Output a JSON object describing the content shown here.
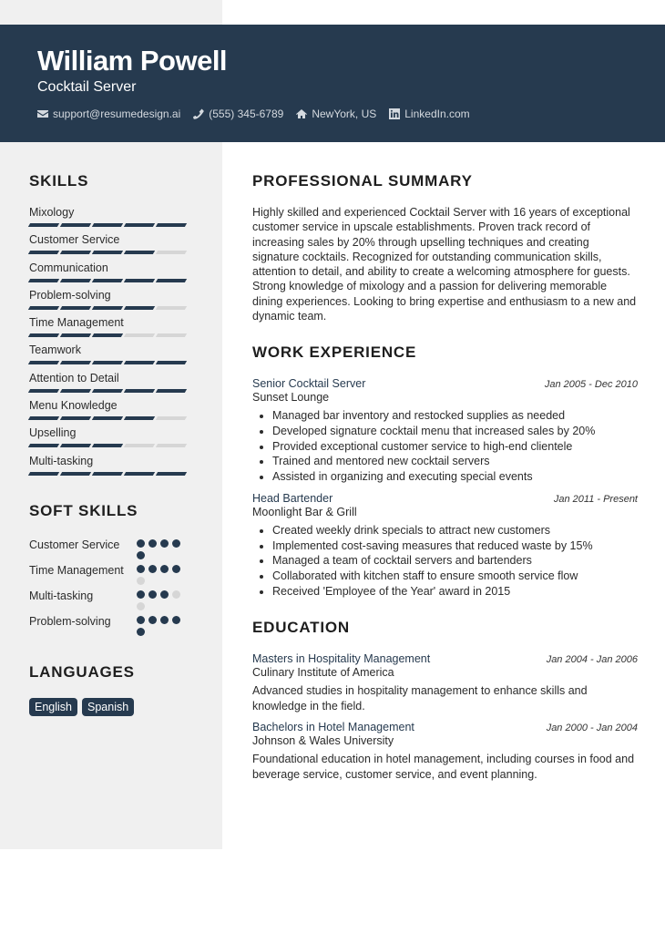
{
  "header": {
    "name": "William Powell",
    "title": "Cocktail Server",
    "contacts": [
      {
        "icon": "envelope-icon",
        "text": "support@resumedesign.ai"
      },
      {
        "icon": "phone-icon",
        "text": "(555) 345-6789"
      },
      {
        "icon": "home-icon",
        "text": "NewYork, US"
      },
      {
        "icon": "linkedin-icon",
        "text": "LinkedIn.com"
      }
    ]
  },
  "sidebar": {
    "skills_heading": "SKILLS",
    "skills": [
      {
        "name": "Mixology",
        "level": 5,
        "max": 5
      },
      {
        "name": "Customer Service",
        "level": 4,
        "max": 5
      },
      {
        "name": "Communication",
        "level": 5,
        "max": 5
      },
      {
        "name": "Problem-solving",
        "level": 4,
        "max": 5
      },
      {
        "name": "Time Management",
        "level": 3,
        "max": 5
      },
      {
        "name": "Teamwork",
        "level": 5,
        "max": 5
      },
      {
        "name": "Attention to Detail",
        "level": 5,
        "max": 5
      },
      {
        "name": "Menu Knowledge",
        "level": 4,
        "max": 5
      },
      {
        "name": "Upselling",
        "level": 3,
        "max": 5
      },
      {
        "name": "Multi-tasking",
        "level": 5,
        "max": 5
      }
    ],
    "soft_skills_heading": "SOFT SKILLS",
    "soft_skills": [
      {
        "name": "Customer Service",
        "level": 5,
        "max": 5
      },
      {
        "name": "Time Management",
        "level": 4,
        "max": 5
      },
      {
        "name": "Multi-tasking",
        "level": 3,
        "max": 5
      },
      {
        "name": "Problem-solving",
        "level": 5,
        "max": 5
      }
    ],
    "languages_heading": "LANGUAGES",
    "languages": [
      "English",
      "Spanish"
    ]
  },
  "main": {
    "summary_heading": "PROFESSIONAL SUMMARY",
    "summary": "Highly skilled and experienced Cocktail Server with 16 years of exceptional customer service in upscale establishments. Proven track record of increasing sales by 20% through upselling techniques and creating signature cocktails. Recognized for outstanding communication skills, attention to detail, and ability to create a welcoming atmosphere for guests. Strong knowledge of mixology and a passion for delivering memorable dining experiences. Looking to bring expertise and enthusiasm to a new and dynamic team.",
    "experience_heading": "WORK EXPERIENCE",
    "experience": [
      {
        "role": "Senior Cocktail Server",
        "dates": "Jan 2005 - Dec 2010",
        "org": "Sunset Lounge",
        "bullets": [
          "Managed bar inventory and restocked supplies as needed",
          "Developed signature cocktail menu that increased sales by 20%",
          "Provided exceptional customer service to high-end clientele",
          "Trained and mentored new cocktail servers",
          "Assisted in organizing and executing special events"
        ]
      },
      {
        "role": "Head Bartender",
        "dates": "Jan 2011 - Present",
        "org": "Moonlight Bar & Grill",
        "bullets": [
          "Created weekly drink specials to attract new customers",
          "Implemented cost-saving measures that reduced waste by 15%",
          "Managed a team of cocktail servers and bartenders",
          "Collaborated with kitchen staff to ensure smooth service flow",
          "Received 'Employee of the Year' award in 2015"
        ]
      }
    ],
    "education_heading": "EDUCATION",
    "education": [
      {
        "degree": "Masters in Hospitality Management",
        "dates": "Jan 2004 - Jan 2006",
        "school": "Culinary Institute of America",
        "description": "Advanced studies in hospitality management to enhance skills and knowledge in the field."
      },
      {
        "degree": "Bachelors in Hotel Management",
        "dates": "Jan 2000 - Jan 2004",
        "school": "Johnson & Wales University",
        "description": "Foundational education in hotel management, including courses in food and beverage service, customer service, and event planning."
      }
    ]
  },
  "colors": {
    "accent": "#263a4f",
    "sidebar_bg": "#f0f0f0",
    "inactive": "#d6d6d6"
  }
}
